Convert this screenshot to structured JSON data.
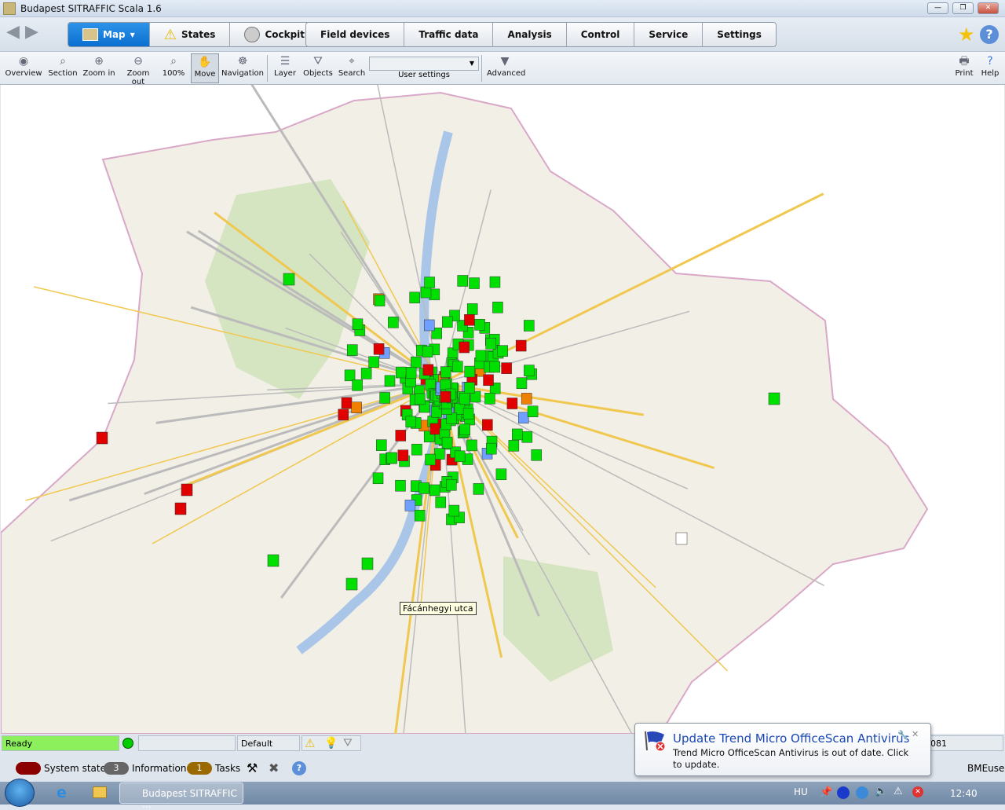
{
  "window": {
    "title": "Budapest SITRAFFIC Scala 1.6"
  },
  "main_tabs": [
    {
      "label": "Map",
      "active": true
    },
    {
      "label": "States"
    },
    {
      "label": "Cockpit"
    }
  ],
  "module_tabs": [
    "Field devices",
    "Traffic data",
    "Analysis",
    "Control",
    "Service",
    "Settings"
  ],
  "tools": [
    "Overview",
    "Section",
    "Zoom in",
    "Zoom out",
    "100%",
    "Move",
    "Navigation",
    "Layer",
    "Objects",
    "Search"
  ],
  "active_tool": "Move",
  "user_settings": {
    "label": "User settings",
    "value": ""
  },
  "advanced": "Advanced",
  "print": "Print",
  "help": "Help",
  "map": {
    "tooltip": "Fácánhegyi utca",
    "marker_colors": {
      "ok": "#00e000",
      "fault": "#e00000",
      "info": "#6fa0ff",
      "warn": "#f08000"
    }
  },
  "status": {
    "ready": "Ready",
    "ready_color": "#8cf05c",
    "profile": "Default",
    "right_value": "081"
  },
  "bottom": {
    "system_state": "System state",
    "information_count": "3",
    "information": "Information",
    "tasks_count": "1",
    "tasks": "Tasks",
    "user": "BMEuser"
  },
  "taskbar": {
    "app_button": "Budapest SITRAFFIC ...",
    "language": "HU",
    "clock": "12:40"
  },
  "notification": {
    "title": "Update Trend Micro OfficeScan Antivirus",
    "message": "Trend Micro OfficeScan Antivirus is out of date. Click to update."
  }
}
